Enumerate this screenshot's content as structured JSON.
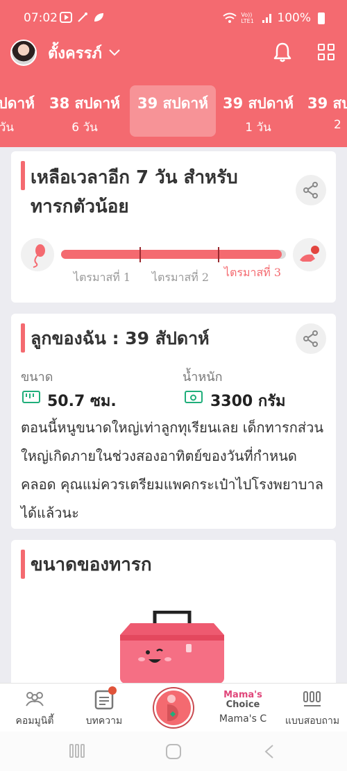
{
  "status_bar": {
    "time": "07:02",
    "carrier": "Vo)) LTE1",
    "battery": "100%"
  },
  "header": {
    "profile_name": "ตั้งครรภ์",
    "weeks": [
      {
        "label": "ปดาห์",
        "sub": "วัน"
      },
      {
        "label": "38 สปดาห์",
        "sub": "6 วัน"
      },
      {
        "label": "39 สปดาห์",
        "sub": ""
      },
      {
        "label": "39 สปดาห์",
        "sub": "1 วัน"
      },
      {
        "label": "39 สบ",
        "sub": "2"
      }
    ],
    "active_week_index": 2
  },
  "countdown_card": {
    "title_line1": "เหลือเวลาอีก 7 วัน สำหรับ",
    "title_line2": "ทารกตัวน้อย",
    "progress_fraction": 0.98,
    "trimesters": [
      "ไตรมาสที่ 1",
      "ไตรมาสที่ 2",
      "ไตรมาสที่ 3"
    ]
  },
  "baby_card": {
    "title": "ลูกของฉัน :  39 สัปดาห์",
    "size_label": "ขนาด",
    "size_value": "50.7 ซม.",
    "weight_label": "น้ำหนัก",
    "weight_value": "3300 กรัม",
    "description": "ตอนนี้หนูขนาดใหญ่เท่าลูกทุเรียนเลย เด็กทารกส่วนใหญ่เกิดภายในช่วงสองอาทิตย์ของวันที่กำหนดคลอด คุณแม่ควรเตรียมแพคกระเป๋าไปโรงพยาบาลได้แล้วนะ"
  },
  "size_card": {
    "title": "ขนาดของทารก"
  },
  "bottom_nav": {
    "items": [
      {
        "label": "คอมมูนิตี้",
        "icon": "community-icon"
      },
      {
        "label": "บทความ",
        "icon": "article-icon"
      },
      {
        "label": "",
        "icon": "pregnancy-icon"
      },
      {
        "label": "Mama's C",
        "icon": "mamas-choice-logo",
        "logo_top": "Mama's",
        "logo_bottom": "Choice"
      },
      {
        "label": "แบบสอบถาม",
        "icon": "survey-icon"
      }
    ]
  },
  "colors": {
    "accent": "#f46a70",
    "green": "#1fae7a"
  }
}
